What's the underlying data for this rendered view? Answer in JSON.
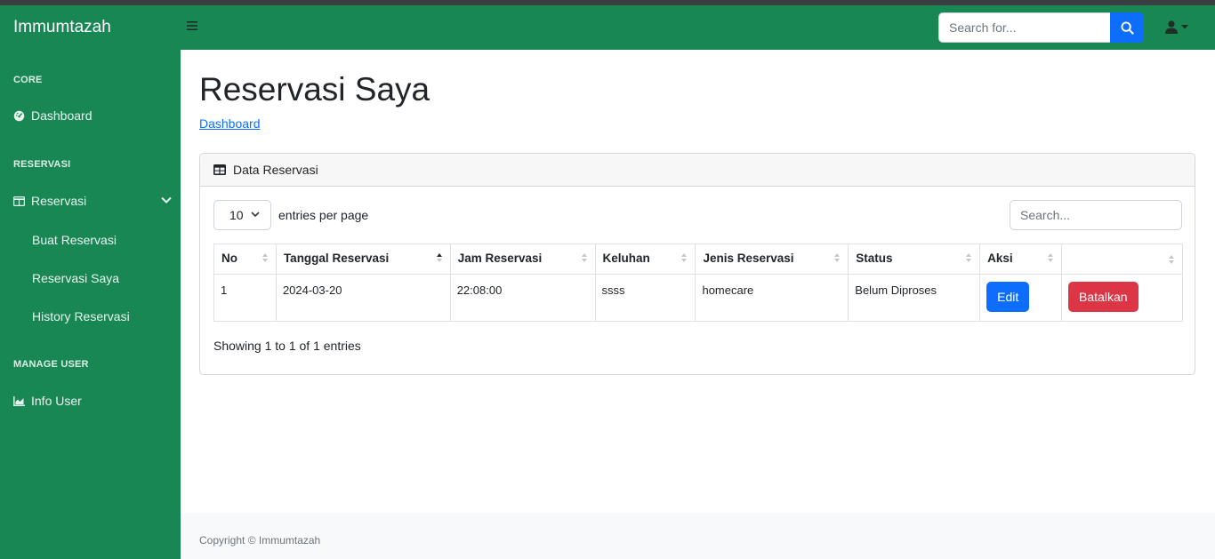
{
  "navbar": {
    "brand": "Immumtazah",
    "search_placeholder": "Search for..."
  },
  "sidebar": {
    "sections": [
      {
        "heading": "CORE"
      },
      {
        "heading": "RESERVASI"
      },
      {
        "heading": "MANAGE USER"
      }
    ],
    "items": [
      {
        "label": "Dashboard",
        "icon": "tachometer-icon"
      },
      {
        "label": "Reservasi",
        "icon": "columns-icon"
      },
      {
        "label": "Buat Reservasi"
      },
      {
        "label": "Reservasi Saya"
      },
      {
        "label": "History Reservasi"
      },
      {
        "label": "Info User",
        "icon": "chart-area-icon"
      }
    ]
  },
  "main": {
    "title": "Reservasi Saya",
    "breadcrumb": "Dashboard",
    "card_title": "Data Reservasi",
    "entries_value": "10",
    "entries_label": "entries per page",
    "search_placeholder": "Search...",
    "columns": [
      "No",
      "Tanggal Reservasi",
      "Jam Reservasi",
      "Keluhan",
      "Jenis Reservasi",
      "Status",
      "Aksi",
      ""
    ],
    "rows": [
      {
        "no": "1",
        "tanggal": "2024-03-20",
        "jam": "22:08:00",
        "keluhan": "ssss",
        "jenis": "homecare",
        "status": "Belum Diproses",
        "edit_label": "Edit",
        "cancel_label": "Batalkan"
      }
    ],
    "showing": "Showing 1 to 1 of 1 entries"
  },
  "footer": {
    "copyright": "Copyright © Immumtazah"
  },
  "colors": {
    "primary_green": "#198754",
    "primary_blue": "#0d6efd",
    "danger_red": "#dc3545"
  }
}
